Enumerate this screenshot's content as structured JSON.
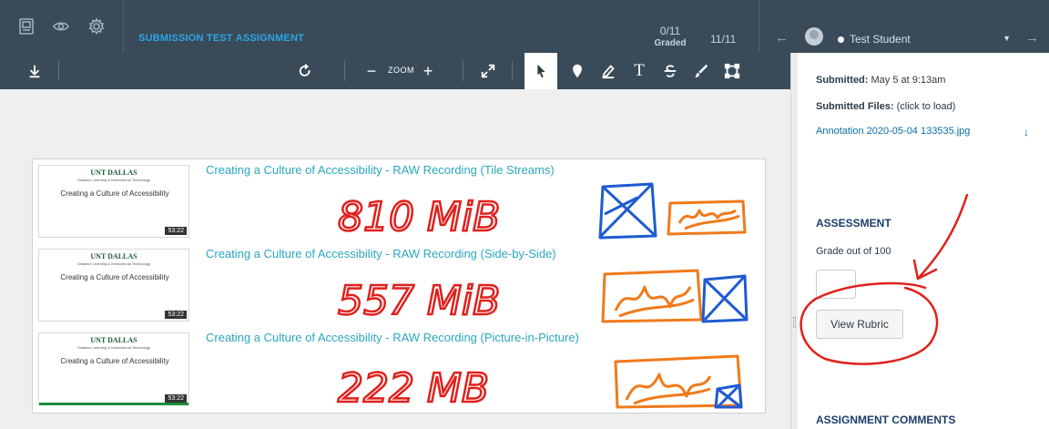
{
  "header": {
    "assignment_title": "SUBMISSION TEST ASSIGNMENT",
    "graded_count": "0/11",
    "graded_label": "Graded",
    "student_count": "11/11",
    "student_name": "Test Student"
  },
  "toolbar": {
    "zoom_label": "ZOOM",
    "active_tool": "pointer"
  },
  "document": {
    "rows": [
      {
        "thumb_brand": "UNT DALLAS",
        "thumb_sub": "Distance Learning & Instructional Technology",
        "thumb_title": "Creating a Culture of Accessibility",
        "duration": "53:22",
        "title": "Creating a Culture of Accessibility - RAW Recording (Tile Streams)",
        "handwritten": "810 MiB"
      },
      {
        "thumb_brand": "UNT DALLAS",
        "thumb_sub": "Distance Learning & Instructional Technology",
        "thumb_title": "Creating a Culture of Accessibility",
        "duration": "53:22",
        "title": "Creating a Culture of Accessibility - RAW Recording (Side-by-Side)",
        "handwritten": "557 MiB"
      },
      {
        "thumb_brand": "UNT DALLAS",
        "thumb_sub": "Distance Learning & Instructional Technology",
        "thumb_title": "Creating a Culture of Accessibility",
        "duration": "53:22",
        "title": "Creating a Culture of Accessibility - RAW Recording (Picture-in-Picture)",
        "handwritten": "222 MB"
      }
    ]
  },
  "sidebar": {
    "submitted_label": "Submitted:",
    "submitted_value": "May 5 at 9:13am",
    "files_label": "Submitted Files:",
    "files_hint": "(click to load)",
    "file_name": "Annotation 2020-05-04 133535.jpg",
    "assessment_heading": "ASSESSMENT",
    "grade_label": "Grade out of 100",
    "grade_value": "",
    "rubric_button": "View Rubric",
    "comments_heading": "ASSIGNMENT COMMENTS"
  },
  "colors": {
    "header_bg": "#394b58",
    "link_blue": "#0770a3",
    "title_teal": "#2aa7c0",
    "ink_red": "#e0201c",
    "ink_blue": "#1f5bd1",
    "ink_orange": "#f07a1a"
  }
}
